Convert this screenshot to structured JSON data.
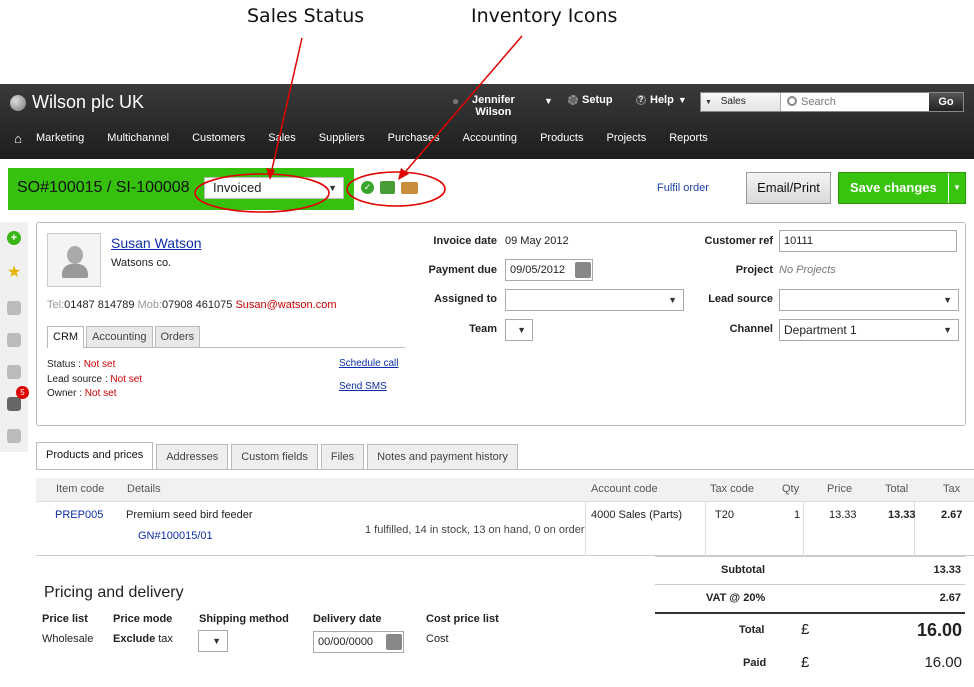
{
  "annotations": {
    "sales_status": "Sales Status",
    "inventory_icons": "Inventory Icons"
  },
  "topbar": {
    "brand": "Wilson plc UK",
    "user_first": "Jennifer",
    "user_last": "Wilson",
    "setup": "Setup",
    "help": "Help",
    "search_scope": "Sales",
    "search_placeholder": "Search",
    "go": "Go",
    "nav": [
      "Marketing",
      "Multichannel",
      "Customers",
      "Sales",
      "Suppliers",
      "Purchases",
      "Accounting",
      "Products",
      "Projects",
      "Reports"
    ]
  },
  "header": {
    "order_id": "SO#100015 / SI-100008",
    "status": "Invoiced",
    "fulfil": "Fulfil order",
    "email_print": "Email/Print",
    "save": "Save changes"
  },
  "rail": {
    "badge": "5"
  },
  "contact": {
    "name": "Susan Watson",
    "company": "Watsons co.",
    "tel_label": "Tel:",
    "tel": "01487 814789",
    "mob_label": "Mob:",
    "mob": "07908 461075",
    "email": "Susan@watson.com",
    "tabs": [
      "CRM",
      "Accounting",
      "Orders"
    ],
    "status_label": "Status : ",
    "lead_label": "Lead source : ",
    "owner_label": "Owner : ",
    "not_set": "Not set",
    "schedule_call": "Schedule call",
    "send_sms": "Send SMS"
  },
  "fields": {
    "invoice_date_label": "Invoice date",
    "invoice_date": "09 May 2012",
    "payment_due_label": "Payment due",
    "payment_due": "09/05/2012",
    "assigned_to_label": "Assigned to",
    "team_label": "Team",
    "customer_ref_label": "Customer ref",
    "customer_ref": "10111",
    "project_label": "Project",
    "project": "No Projects",
    "lead_source_label": "Lead source",
    "channel_label": "Channel",
    "channel": "Department 1"
  },
  "tabs": [
    "Products and prices",
    "Addresses",
    "Custom fields",
    "Files",
    "Notes and payment history"
  ],
  "table": {
    "headers": {
      "item_code": "Item code",
      "details": "Details",
      "account_code": "Account code",
      "tax_code": "Tax code",
      "qty": "Qty",
      "price": "Price",
      "total": "Total",
      "tax": "Tax"
    },
    "row": {
      "item_code": "PREP005",
      "details": "Premium seed bird feeder",
      "gn": "GN#100015/01",
      "stock": "1 fulfilled, 14 in stock, 13 on hand, 0 on order",
      "account_code": "4000 Sales (Parts)",
      "tax_code": "T20",
      "qty": "1",
      "price": "13.33",
      "total": "13.33",
      "tax": "2.67"
    }
  },
  "pricing": {
    "title": "Pricing and delivery",
    "price_list_label": "Price list",
    "price_list": "Wholesale",
    "price_mode_label": "Price mode",
    "price_mode_bold": "Exclude",
    "price_mode_rest": " tax",
    "shipping_label": "Shipping method",
    "delivery_label": "Delivery date",
    "delivery": "00/00/0000",
    "cost_list_label": "Cost price list",
    "cost_list": "Cost"
  },
  "totals": {
    "subtotal_label": "Subtotal",
    "subtotal": "13.33",
    "vat_label": "VAT @ 20%",
    "vat": "2.67",
    "total_label": "Total",
    "currency": "£",
    "total": "16.00",
    "paid_label": "Paid",
    "paid": "16.00"
  }
}
